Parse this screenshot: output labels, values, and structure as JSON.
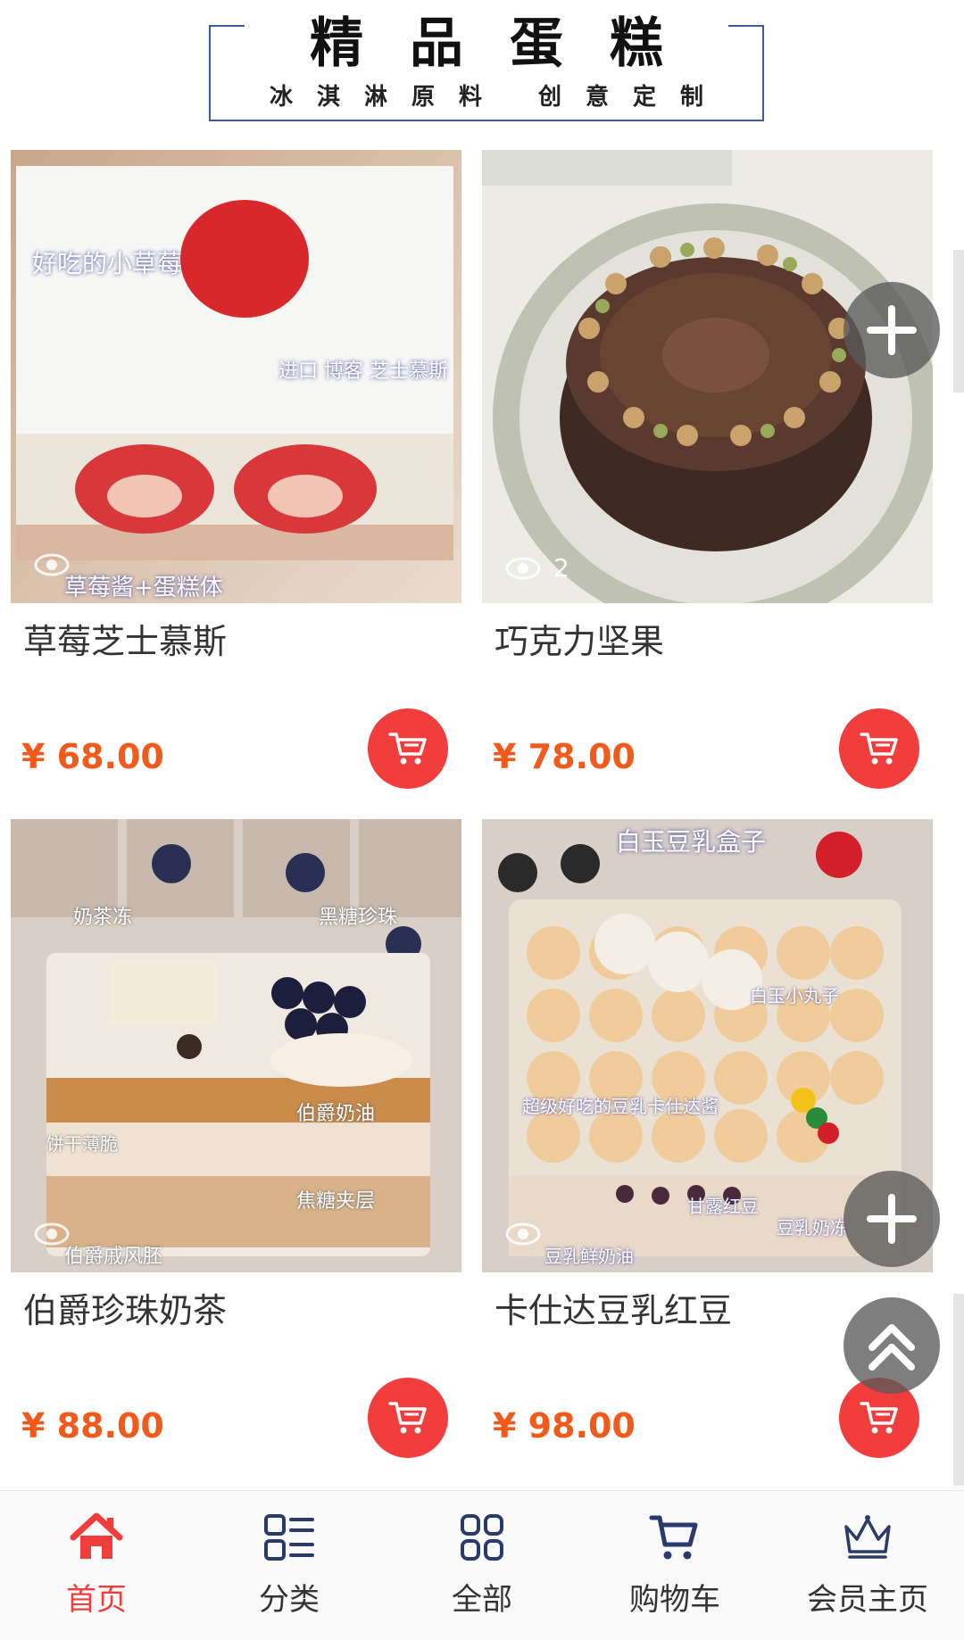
{
  "banner": {
    "title": "精品蛋糕",
    "subtitle": "冰淇淋原料  创意定制"
  },
  "products": [
    {
      "name": "草莓芝士慕斯",
      "price": "¥ 68.00",
      "views": "",
      "overlay_text": [
        "好吃的小草莓",
        "进口 博客 芝士慕斯",
        "草莓酱+蛋糕体"
      ]
    },
    {
      "name": "巧克力坚果",
      "price": "¥ 78.00",
      "views": "2"
    },
    {
      "name": "伯爵珍珠奶茶",
      "price": "¥ 88.00",
      "views": "",
      "overlay_text": [
        "奶茶冻",
        "黑糖珍珠",
        "伯爵奶油",
        "饼干薄脆",
        "焦糖夹层",
        "伯爵戚风胚"
      ]
    },
    {
      "name": "卡仕达豆乳红豆",
      "price": "¥ 98.00",
      "views": "",
      "overlay_text": [
        "白玉豆乳盒子",
        "白玉小丸子",
        "超级好吃的豆乳卡仕达酱",
        "甘露红豆",
        "豆乳奶冻",
        "豆乳鲜奶油"
      ]
    }
  ],
  "nav": [
    {
      "label": "首页",
      "icon": "home-icon",
      "active": true
    },
    {
      "label": "分类",
      "icon": "category-list-icon",
      "active": false
    },
    {
      "label": "全部",
      "icon": "grid-icon",
      "active": false
    },
    {
      "label": "购物车",
      "icon": "cart-icon",
      "active": false
    },
    {
      "label": "会员主页",
      "icon": "crown-icon",
      "active": false
    }
  ],
  "colors": {
    "accent": "#f23d3d",
    "price": "#f25a1c",
    "banner_border": "#3b5b9a"
  }
}
